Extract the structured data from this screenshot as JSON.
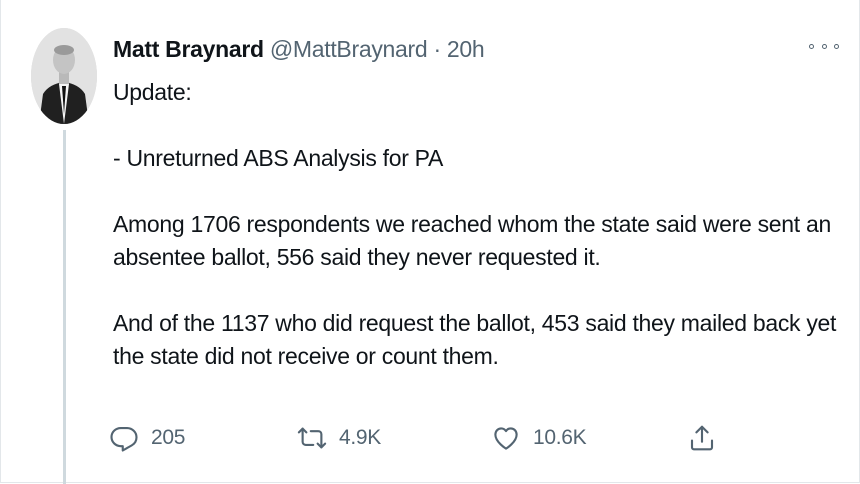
{
  "tweet": {
    "display_name": "Matt Braynard",
    "handle": "@MattBraynard",
    "separator": " · ",
    "time": "20h",
    "paragraphs": [
      "Update:",
      "- Unreturned ABS Analysis for PA",
      "Among 1706 respondents we reached whom the state said were sent an",
      "absentee ballot, 556 said they never requested it.",
      "And of the 1137 who did request the ballot, 453 said they mailed back yet",
      "the state did not receive or count them."
    ]
  },
  "actions": {
    "reply_count": "205",
    "retweet_count": "4.9K",
    "like_count": "10.6K"
  },
  "icons": {
    "more": "more-options-icon",
    "reply": "reply-icon",
    "retweet": "retweet-icon",
    "like": "heart-icon",
    "share": "share-icon"
  },
  "colors": {
    "text": "#0f1419",
    "secondary": "#536471",
    "thread_line": "#cfd9de"
  }
}
